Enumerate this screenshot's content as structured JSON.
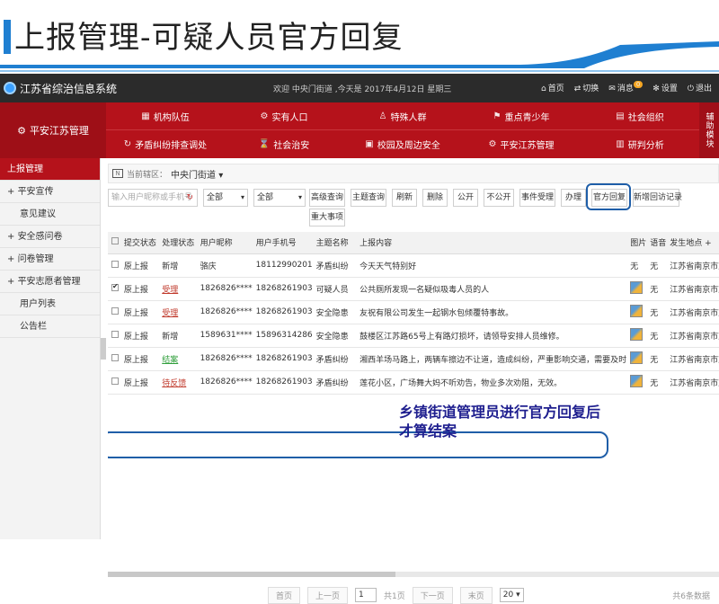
{
  "slide": {
    "title": "上报管理-可疑人员官方回复"
  },
  "topbar": {
    "app_name": "江苏省综治信息系统",
    "welcome": "欢迎 中央门街道 ,今天是 2017年4月12日 星期三",
    "actions": {
      "home": "首页",
      "switch": "切换",
      "messages": "消息",
      "message_count": "0",
      "settings": "设置",
      "logout": "退出"
    }
  },
  "menu": {
    "brand": "平安江苏管理",
    "row1": [
      "机构队伍",
      "实有人口",
      "特殊人群",
      "重点青少年",
      "社会组织"
    ],
    "row2": [
      "矛盾纠纷排查调处",
      "社会治安",
      "校园及周边安全",
      "平安江苏管理",
      "研判分析"
    ],
    "side": "辅助模块"
  },
  "sidebar": {
    "items": [
      {
        "label": "上报管理",
        "prefix": ""
      },
      {
        "label": "平安宣传",
        "prefix": "+ "
      },
      {
        "label": "意见建议",
        "prefix": ""
      },
      {
        "label": "安全感问卷",
        "prefix": "+ "
      },
      {
        "label": "问卷管理",
        "prefix": "+ "
      },
      {
        "label": "平安志愿者管理",
        "prefix": "+ "
      },
      {
        "label": "用户列表",
        "prefix": ""
      },
      {
        "label": "公告栏",
        "prefix": ""
      }
    ]
  },
  "breadcrumb": {
    "label": "当前辖区：",
    "value": "中央门街道"
  },
  "toolbar": {
    "search_placeholder": "输入用户昵称或手机号",
    "select1": "全部",
    "select2": "全部",
    "advanced_search": "高级查询",
    "topic_search": "主题查询",
    "refresh": "刷新",
    "delete": "删除",
    "public": "公开",
    "private": "不公开",
    "accept": "事件受理",
    "handle": "办理",
    "official_reply": "官方回复",
    "add_visit": "新增回访记录",
    "major": "重大事项"
  },
  "table": {
    "headers": [
      "提交状态",
      "处理状态",
      "用户昵称",
      "用户手机号",
      "主题名称",
      "上报内容",
      "图片",
      "语音",
      "发生地点"
    ],
    "rows": [
      [
        "原上报",
        "新增",
        "骆庆",
        "18112990201",
        "矛盾纠纷",
        "今天天气特别好",
        "无",
        "无",
        "江苏省南京市鼓"
      ],
      [
        "原上报",
        "受理",
        "1826826****",
        "18268261903",
        "可疑人员",
        "公共厕所发现一名疑似吸毒人员的人",
        "",
        "无",
        "江苏省南京市鼓"
      ],
      [
        "原上报",
        "受理",
        "1826826****",
        "18268261903",
        "安全隐患",
        "友祝有限公司发生一起钢水包倾覆特事故。",
        "",
        "无",
        "江苏省南京市鼓"
      ],
      [
        "原上报",
        "新增",
        "1589631****",
        "15896314286",
        "安全隐患",
        "鼓楼区江苏路65号上有路灯损坏，请领导安排人员维修。",
        "",
        "无",
        "江苏省南京市鼓"
      ],
      [
        "原上报",
        "结案",
        "1826826****",
        "18268261903",
        "矛盾纠纷",
        "湘西羊场马路上，两辆车擦边不让道，造成纠纷，严重影响交通，需要及时",
        "",
        "无",
        "江苏省南京市鼓"
      ],
      [
        "原上报",
        "待反馈",
        "1826826****",
        "18268261903",
        "矛盾纠纷",
        "莲花小区，广场舞大妈不听劝告，物业多次劝阻，无效。",
        "",
        "无",
        "江苏省南京市鼓"
      ]
    ],
    "checked_row": 1,
    "status_colors": {
      "受理": "#c0392b",
      "结案": "#2e9e3a",
      "待反馈": "#c0392b",
      "新增": "#333333"
    }
  },
  "annotation": "乡镇街道管理员进行官方回复后\n才算结案",
  "pager": {
    "first": "首页",
    "prev": "上一页",
    "page": "1",
    "total_pages": "共1页",
    "next": "下一页",
    "last": "末页",
    "page_size": "20",
    "total": "共6条数据"
  }
}
